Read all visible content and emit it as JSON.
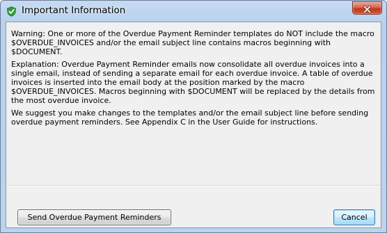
{
  "window": {
    "title": "Important Information",
    "icon": "green-check-shield-icon",
    "close_icon": "close-x-icon"
  },
  "message": {
    "warning": "Warning: One or more of the Overdue Payment Reminder templates do NOT include the macro $OVERDUE_INVOICES and/or the email subject line contains macros beginning with $DOCUMENT.",
    "explanation": "Explanation: Overdue Payment Reminder emails now consolidate all overdue invoices into a single email, instead of sending a separate email for each overdue invoice. A table of overdue invoices is inserted into the email body at the position marked by the macro $OVERDUE_INVOICES. Macros beginning with $DOCUMENT will be replaced by the details from the most overdue invoice.",
    "suggestion": "We suggest you make changes to the templates and/or the email subject line before sending overdue payment reminders. See Appendix C in the User Guide for instructions."
  },
  "buttons": {
    "send_label": "Send Overdue Payment Reminders",
    "cancel_label": "Cancel"
  },
  "colors": {
    "title_bar": "#bcd3ed",
    "close_button": "#c9452c",
    "client_background": "#f0f0f0",
    "default_button_border": "#3c7fb1"
  }
}
